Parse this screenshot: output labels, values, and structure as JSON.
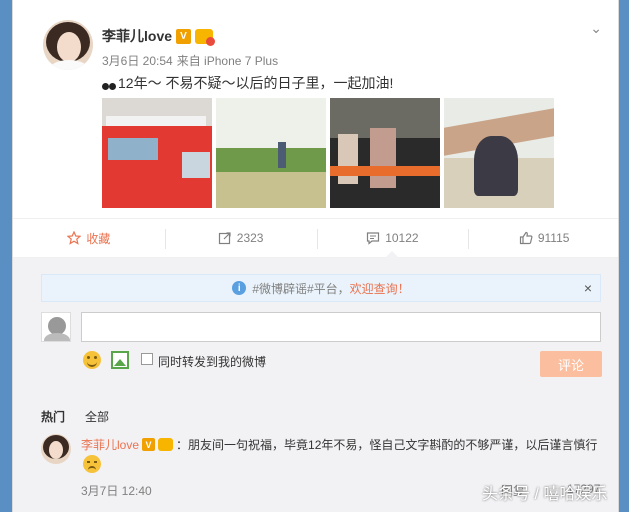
{
  "post": {
    "author_name": "李菲儿love",
    "verified_badge": "V",
    "date": "3月6日 20:54",
    "source": "来自 iPhone 7 Plus",
    "text": "12年～ 不易不疑～以后的日子里，一起加油!",
    "dropdown_icon": "⌄"
  },
  "actions": {
    "favorite_label": "收藏",
    "repost_count": "2323",
    "comment_count": "10122",
    "like_count": "91115"
  },
  "comment_box": {
    "notice_before": "#微博辟谣#平台，",
    "notice_accent": "欢迎查询！",
    "notice_close": "×",
    "repost_checkbox_label": "同时转发到我的微博",
    "submit_label": "评论"
  },
  "tabs": {
    "hot": "热门",
    "all": "全部"
  },
  "top_comment": {
    "author_name": "李菲儿love",
    "verified_badge": "V",
    "text": "：朋友间一句祝福，毕竟12年不易，怪自己文字斟酌的不够严谨，以后谨言慎行",
    "date": "3月7日 12:40",
    "reply_label": "回复",
    "like_count": "17297"
  },
  "watermark": "头条号 / 嘻哈娱乐",
  "colors": {
    "accent": "#eb7350",
    "muted": "#808080",
    "badge": "#f0a000"
  }
}
